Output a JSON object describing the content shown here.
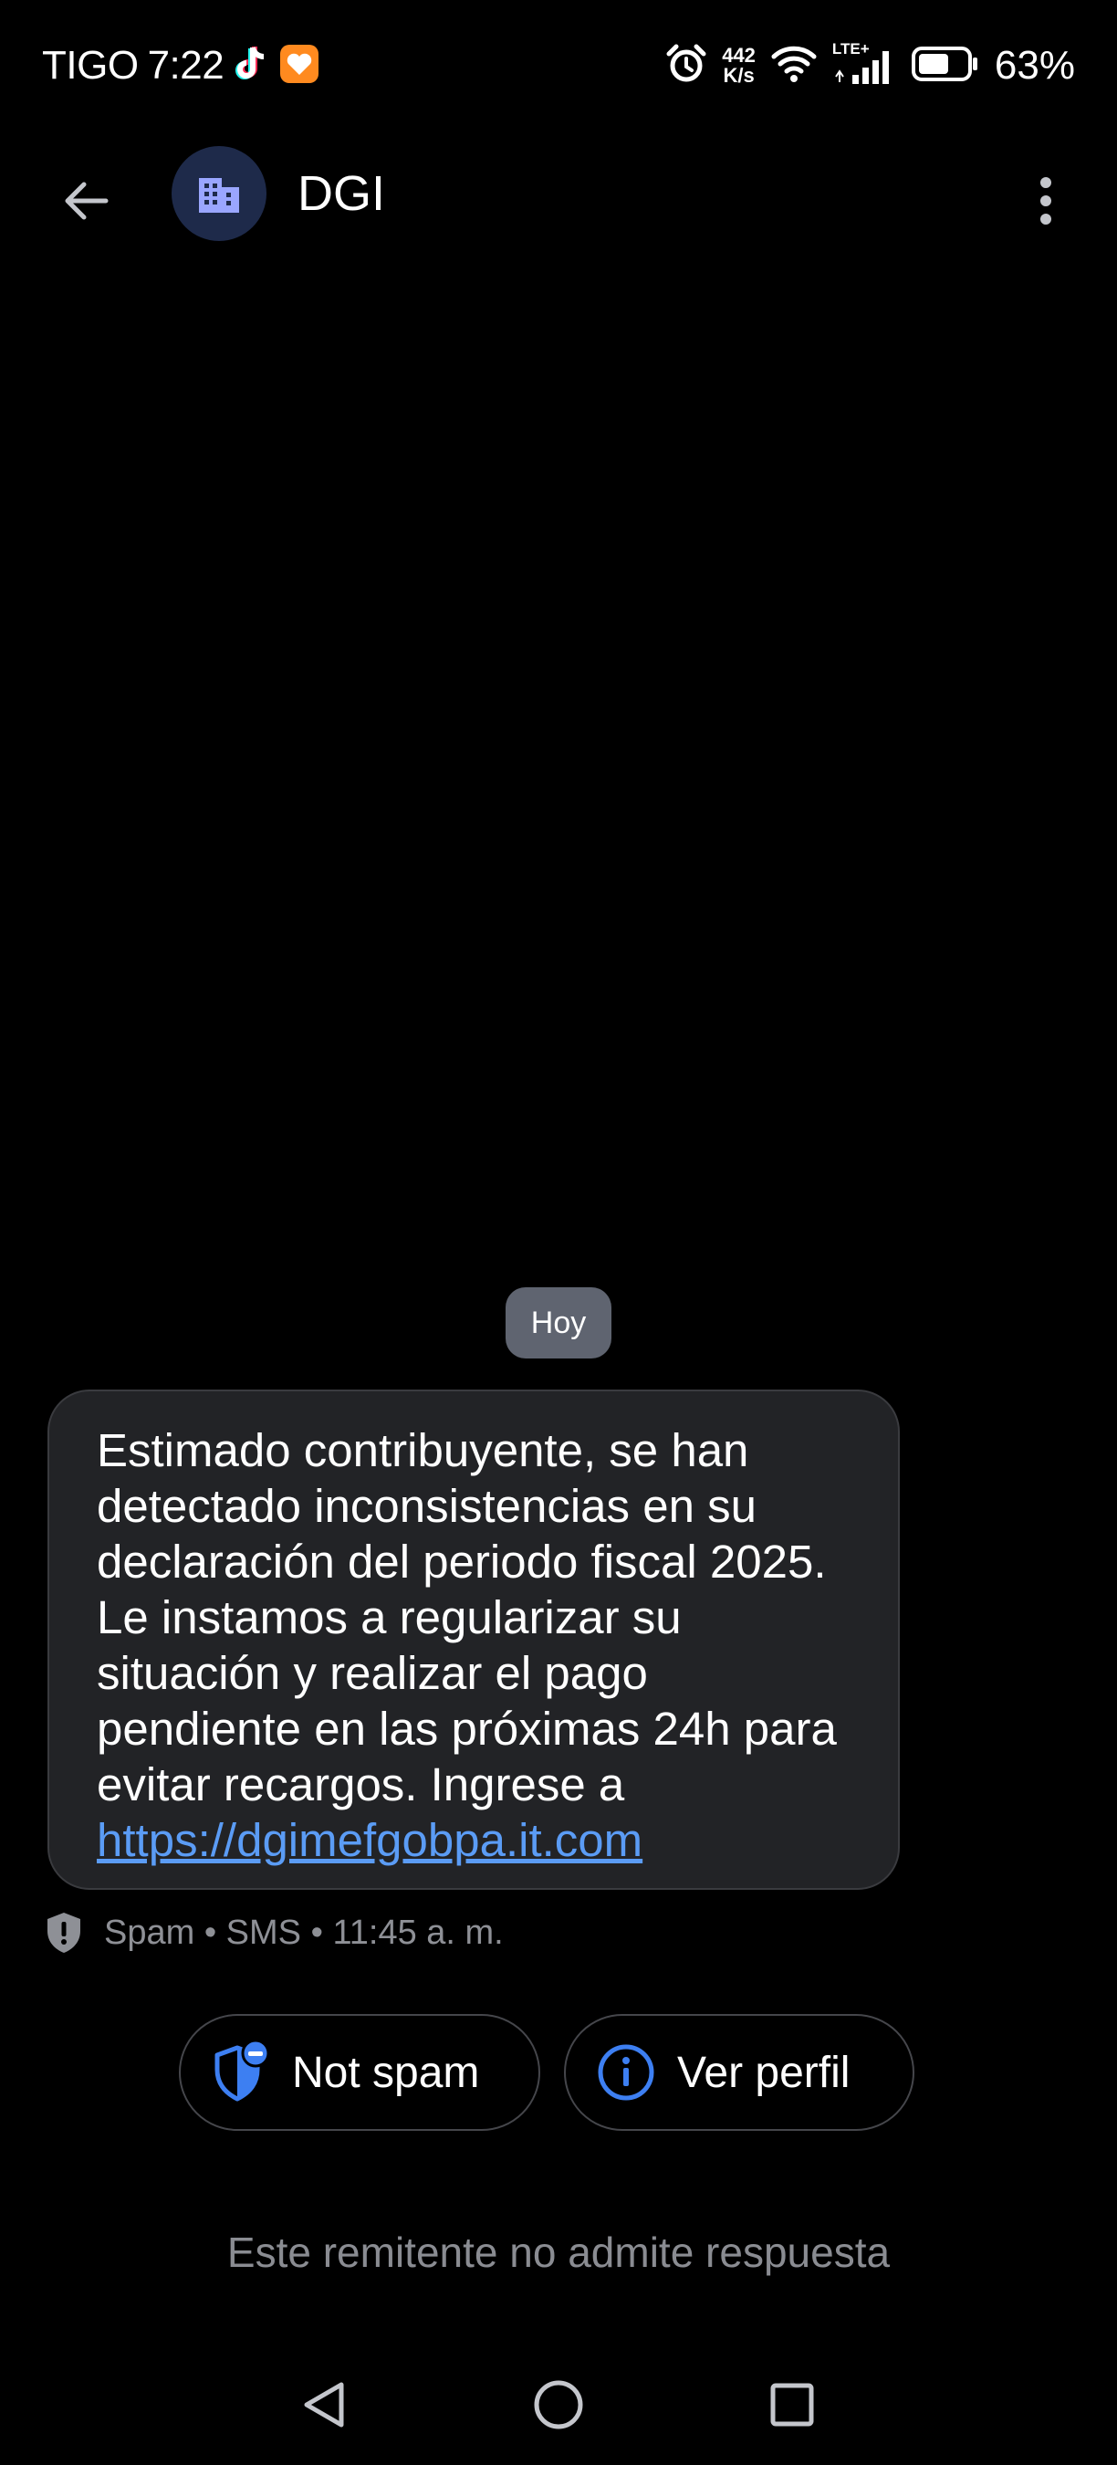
{
  "status_bar": {
    "carrier": "TIGO",
    "time": "7:22",
    "net_speed_value": "442",
    "net_speed_unit": "K/s",
    "network_type": "LTE+",
    "battery_percent": "63%",
    "battery_level": 0.63
  },
  "header": {
    "contact_name": "DGI",
    "avatar_color": "#1e2a4a",
    "avatar_icon": "building-icon"
  },
  "conversation": {
    "date_label": "Hoy",
    "message": {
      "text": "Estimado contribuyente, se han detectado inconsistencias en su declaración del periodo fiscal 2025. Le instamos a regularizar su situación y realizar el pago pendiente en las próximas 24h para evitar recargos. Ingrese a",
      "link": "https://dgimefgobpa.it.com",
      "meta": "Spam • SMS • 11:45 a. m."
    }
  },
  "actions": {
    "not_spam_label": "Not spam",
    "view_profile_label": "Ver perfil",
    "accent_color": "#3d7ff2"
  },
  "footer": {
    "reply_note": "Este remitente no admite respuesta"
  }
}
